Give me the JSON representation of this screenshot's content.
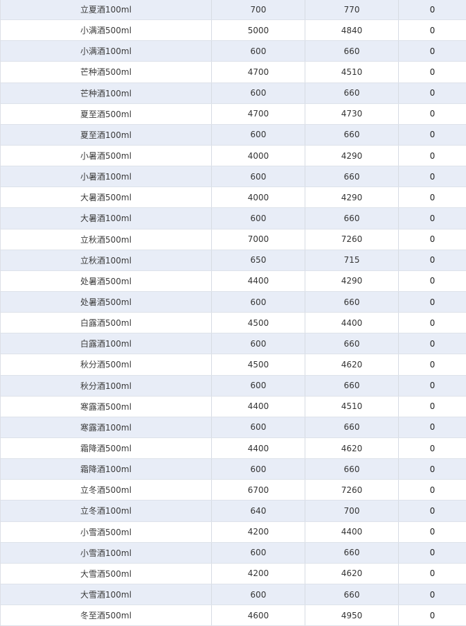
{
  "table": {
    "rows": [
      [
        "立夏酒100ml",
        "700",
        "770",
        "0"
      ],
      [
        "小满酒500ml",
        "5000",
        "4840",
        "0"
      ],
      [
        "小满酒100ml",
        "600",
        "660",
        "0"
      ],
      [
        "芒种酒500ml",
        "4700",
        "4510",
        "0"
      ],
      [
        "芒种酒100ml",
        "600",
        "660",
        "0"
      ],
      [
        "夏至酒500ml",
        "4700",
        "4730",
        "0"
      ],
      [
        "夏至酒100ml",
        "600",
        "660",
        "0"
      ],
      [
        "小暑酒500ml",
        "4000",
        "4290",
        "0"
      ],
      [
        "小暑酒100ml",
        "600",
        "660",
        "0"
      ],
      [
        "大暑酒500ml",
        "4000",
        "4290",
        "0"
      ],
      [
        "大暑酒100ml",
        "600",
        "660",
        "0"
      ],
      [
        "立秋酒500ml",
        "7000",
        "7260",
        "0"
      ],
      [
        "立秋酒100ml",
        "650",
        "715",
        "0"
      ],
      [
        "处暑酒500ml",
        "4400",
        "4290",
        "0"
      ],
      [
        "处暑酒500ml",
        "600",
        "660",
        "0"
      ],
      [
        "白露酒500ml",
        "4500",
        "4400",
        "0"
      ],
      [
        "白露酒100ml",
        "600",
        "660",
        "0"
      ],
      [
        "秋分酒500ml",
        "4500",
        "4620",
        "0"
      ],
      [
        "秋分酒100ml",
        "600",
        "660",
        "0"
      ],
      [
        "寒露酒500ml",
        "4400",
        "4510",
        "0"
      ],
      [
        "寒露酒100ml",
        "600",
        "660",
        "0"
      ],
      [
        "霜降酒500ml",
        "4400",
        "4620",
        "0"
      ],
      [
        "霜降酒100ml",
        "600",
        "660",
        "0"
      ],
      [
        "立冬酒500ml",
        "6700",
        "7260",
        "0"
      ],
      [
        "立冬酒100ml",
        "640",
        "700",
        "0"
      ],
      [
        "小雪酒500ml",
        "4200",
        "4400",
        "0"
      ],
      [
        "小雪酒100ml",
        "600",
        "660",
        "0"
      ],
      [
        "大雪酒500ml",
        "4200",
        "4620",
        "0"
      ],
      [
        "大雪酒100ml",
        "600",
        "660",
        "0"
      ],
      [
        "冬至酒500ml",
        "4600",
        "4950",
        "0"
      ]
    ]
  },
  "colors": {
    "shaded_row": "#e8edf7",
    "plain_row": "#ffffff",
    "border": "#d6dbe3"
  }
}
